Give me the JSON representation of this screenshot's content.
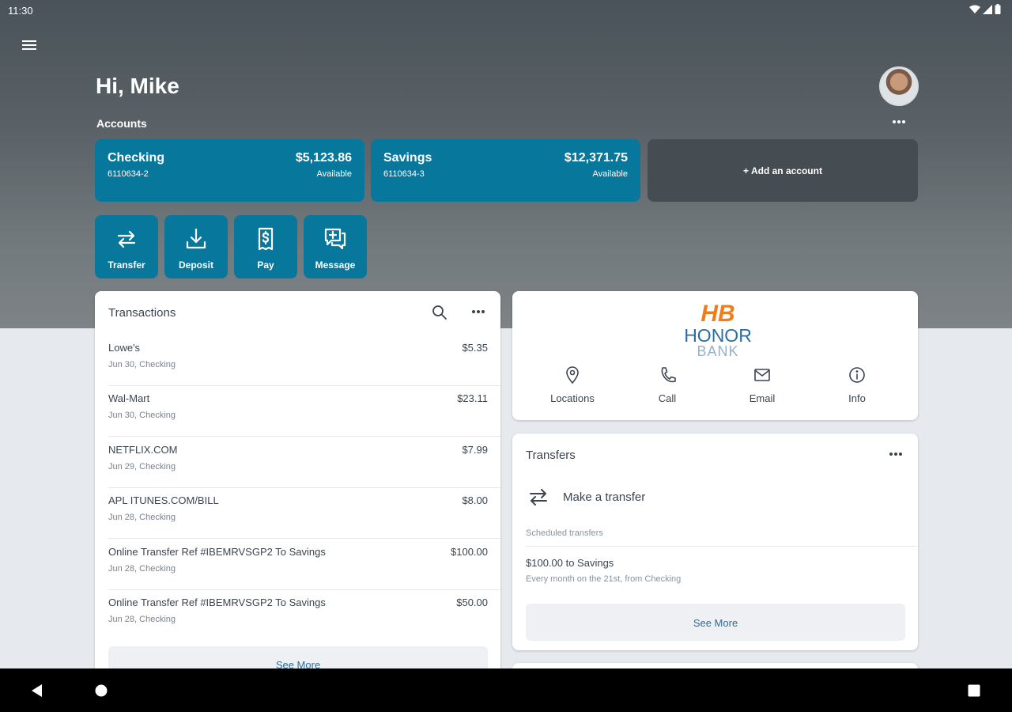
{
  "status_bar": {
    "time": "11:30"
  },
  "header": {
    "greeting": "Hi, Mike",
    "accounts_label": "Accounts"
  },
  "accounts": [
    {
      "name": "Checking",
      "number": "6110634-2",
      "balance": "$5,123.86",
      "balance_label": "Available"
    },
    {
      "name": "Savings",
      "number": "6110634-3",
      "balance": "$12,371.75",
      "balance_label": "Available"
    }
  ],
  "add_account_label": "+ Add an account",
  "actions": [
    {
      "label": "Transfer",
      "icon": "transfer-icon"
    },
    {
      "label": "Deposit",
      "icon": "deposit-icon"
    },
    {
      "label": "Pay",
      "icon": "pay-icon"
    },
    {
      "label": "Message",
      "icon": "message-icon"
    }
  ],
  "transactions": {
    "title": "Transactions",
    "items": [
      {
        "description": "Lowe's",
        "meta": "Jun 30, Checking",
        "amount": "$5.35"
      },
      {
        "description": "Wal-Mart",
        "meta": "Jun 30, Checking",
        "amount": "$23.11"
      },
      {
        "description": "NETFLIX.COM",
        "meta": "Jun 29, Checking",
        "amount": "$7.99"
      },
      {
        "description": "APL ITUNES.COM/BILL",
        "meta": "Jun 28, Checking",
        "amount": "$8.00"
      },
      {
        "description": "Online Transfer Ref #IBEMRVSGP2 To Savings",
        "meta": "Jun 28, Checking",
        "amount": "$100.00"
      },
      {
        "description": "Online Transfer Ref #IBEMRVSGP2 To Savings",
        "meta": "Jun 28, Checking",
        "amount": "$50.00"
      }
    ],
    "see_more": "See More"
  },
  "bank": {
    "logo_mark": "HB",
    "logo_name": "HONOR",
    "logo_sub": "BANK",
    "contacts": [
      {
        "label": "Locations",
        "icon": "location-pin-icon"
      },
      {
        "label": "Call",
        "icon": "phone-icon"
      },
      {
        "label": "Email",
        "icon": "email-icon"
      },
      {
        "label": "Info",
        "icon": "info-icon"
      }
    ]
  },
  "transfers": {
    "title": "Transfers",
    "make_transfer": "Make a transfer",
    "scheduled_label": "Scheduled transfers",
    "scheduled": [
      {
        "title": "$100.00 to Savings",
        "detail": "Every month on the 21st, from Checking"
      }
    ],
    "see_more": "See More"
  },
  "colors": {
    "brand_teal": "#08779c",
    "logo_orange": "#f07c1c",
    "logo_blue": "#2a6e9e",
    "link_blue": "#2b6e9c"
  }
}
